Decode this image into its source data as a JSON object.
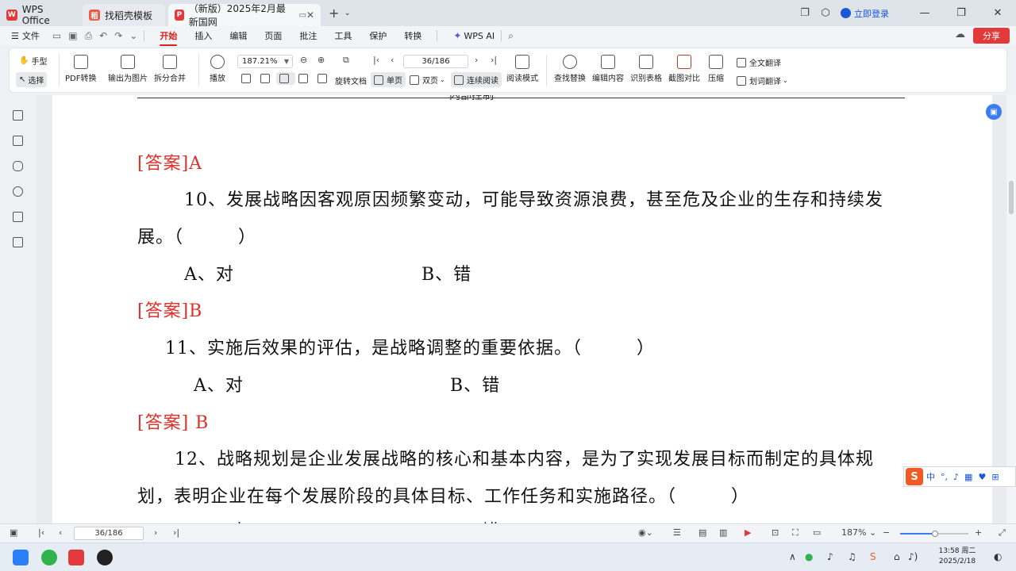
{
  "tabs": [
    {
      "label": "WPS Office"
    },
    {
      "label": "找稻壳模板"
    },
    {
      "label": "（新版）2025年2月最新国网"
    }
  ],
  "titlebar": {
    "login": "立即登录"
  },
  "menu": {
    "file": "文件",
    "items": [
      "开始",
      "插入",
      "编辑",
      "页面",
      "批注",
      "工具",
      "保护",
      "转换"
    ],
    "ai": "WPS AI",
    "share": "分享"
  },
  "toolbar": {
    "hand": "手型",
    "select": "选择",
    "pdf_convert": "PDF转换",
    "export_image": "输出为图片",
    "split_merge": "拆分合并",
    "play": "播放",
    "zoom_value": "187.21%",
    "page_value": "36/186",
    "rotate": "旋转文档",
    "single_page": "单页",
    "double_page": "双页",
    "continuous": "连续阅读",
    "reading_mode": "阅读模式",
    "find_replace": "查找替换",
    "edit_content": "编辑内容",
    "recognize_table": "识别表格",
    "screenshot_compare": "截图对比",
    "compress": "压缩",
    "full_translate": "全文翻译",
    "word_translate": "划词翻译"
  },
  "document": {
    "header_partial": "内部控制",
    "lines": [
      {
        "text": "[答案]A",
        "kind": "answer"
      },
      {
        "text": "10、发展战略因客观原因频繁变动，可能导致资源浪费，甚至危及企业的生存和持续发",
        "kind": "q"
      },
      {
        "text": "展。（　　　）",
        "kind": "q"
      },
      {
        "text": "A、对",
        "kind": "opt"
      },
      {
        "text": "B、错",
        "kind": "opt"
      },
      {
        "text": "[答案]B",
        "kind": "answer"
      },
      {
        "text": "11、实施后效果的评估，是战略调整的重要依据。（　　　）",
        "kind": "q"
      },
      {
        "text": "A、对",
        "kind": "opt"
      },
      {
        "text": "B、错",
        "kind": "opt"
      },
      {
        "text": "[答案] B",
        "kind": "answer"
      },
      {
        "text": "12、战略规划是企业发展战略的核心和基本内容，是为了实现发展目标而制定的具体规",
        "kind": "q"
      },
      {
        "text": "划，表明企业在每个发展阶段的具体目标、工作任务和实施路径。（　　　）",
        "kind": "q"
      },
      {
        "text": "A、对",
        "kind": "opt"
      },
      {
        "text": "B、错",
        "kind": "opt"
      }
    ]
  },
  "ime": {
    "lang": "中"
  },
  "statusbar": {
    "page": "36/186",
    "zoom": "187%"
  },
  "clock": {
    "time": "13:58 周二",
    "date": "2025/2/18"
  }
}
